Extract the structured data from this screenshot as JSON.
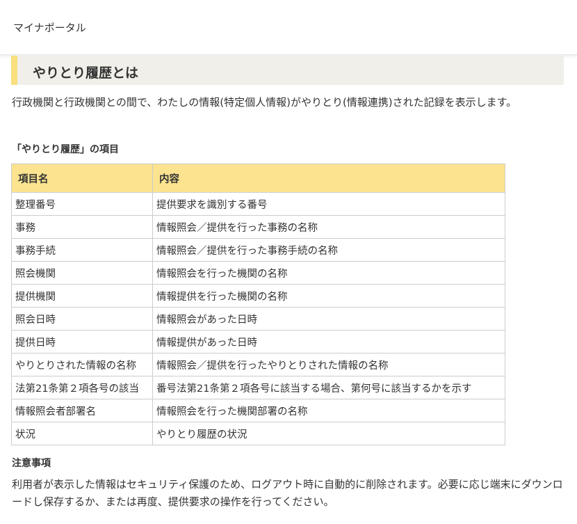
{
  "header": {
    "brand": "マイナポータル"
  },
  "section": {
    "title": "やりとり履歴とは",
    "intro": "行政機関と行政機関との間で、わたしの情報(特定個人情報)がやりとり(情報連携)された記録を表示します。"
  },
  "items_table": {
    "caption": "「やりとり履歴」の項目",
    "headers": [
      "項目名",
      "内容"
    ],
    "rows": [
      [
        "整理番号",
        "提供要求を識別する番号"
      ],
      [
        "事務",
        "情報照会／提供を行った事務の名称"
      ],
      [
        "事務手続",
        "情報照会／提供を行った事務手続の名称"
      ],
      [
        "照会機関",
        "情報照会を行った機関の名称"
      ],
      [
        "提供機関",
        "情報提供を行った機関の名称"
      ],
      [
        "照会日時",
        "情報照会があった日時"
      ],
      [
        "提供日時",
        "情報提供があった日時"
      ],
      [
        "やりとりされた情報の名称",
        "情報照会／提供を行ったやりとりされた情報の名称"
      ],
      [
        "法第21条第２項各号の該当",
        "番号法第21条第２項各号に該当する場合、第何号に該当するかを示す"
      ],
      [
        "情報照会者部署名",
        "情報照会を行った機関部署の名称"
      ],
      [
        "状況",
        "やりとり履歴の状況"
      ]
    ]
  },
  "notes": {
    "title": "注意事項",
    "body": "利用者が表示した情報はセキュリティ保護のため、ログアウト時に自動的に削除されます。必要に応じ端末にダウンロードし保存するか、または再度、提供要求の操作を行ってください。"
  },
  "colors": {
    "heading_accent": "#f7e07d",
    "heading_bg": "#f0efe9",
    "table_header_bg": "#fbe38f"
  }
}
